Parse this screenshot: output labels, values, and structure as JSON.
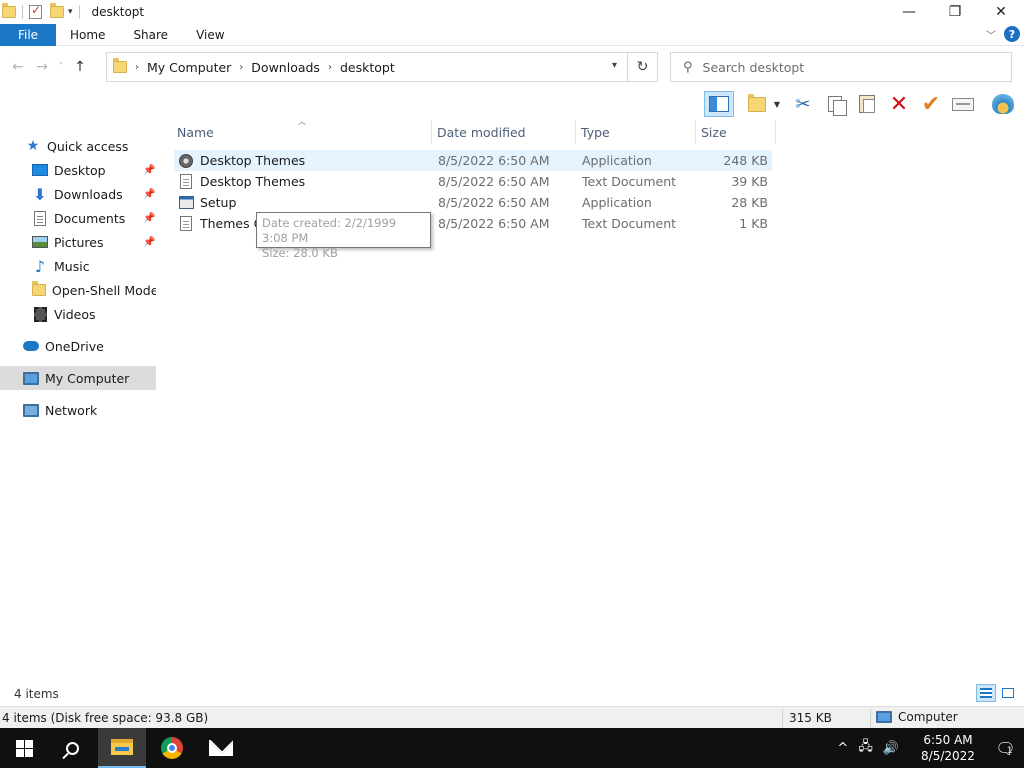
{
  "window": {
    "title": "desktopt",
    "controls": {
      "minimize": "—",
      "restore": "❐",
      "close": "✕"
    }
  },
  "ribbon": {
    "tabs": [
      "File",
      "Home",
      "Share",
      "View"
    ],
    "help": "?",
    "expand": "﹀"
  },
  "address": {
    "crumbs": [
      "My Computer",
      "Downloads",
      "desktopt"
    ],
    "separator": "›",
    "refresh": "↻",
    "dropdown": "▾"
  },
  "search": {
    "placeholder": "Search desktopt"
  },
  "nav": {
    "back": "←",
    "forward": "→",
    "recent": "˅",
    "up": "↑"
  },
  "sidebar": {
    "items": [
      {
        "label": "Quick access",
        "icon": "star-icon"
      },
      {
        "label": "Desktop",
        "icon": "desktop-icon",
        "pinned": true
      },
      {
        "label": "Downloads",
        "icon": "download-icon",
        "pinned": true
      },
      {
        "label": "Documents",
        "icon": "document-icon",
        "pinned": true
      },
      {
        "label": "Pictures",
        "icon": "pictures-icon",
        "pinned": true
      },
      {
        "label": "Music",
        "icon": "music-icon"
      },
      {
        "label": "Open-Shell Modern",
        "icon": "folder-icon"
      },
      {
        "label": "Videos",
        "icon": "video-icon"
      },
      {
        "label": "OneDrive",
        "icon": "cloud-icon"
      },
      {
        "label": "My Computer",
        "icon": "computer-icon",
        "selected": true
      },
      {
        "label": "Network",
        "icon": "network-icon"
      }
    ]
  },
  "list": {
    "columns": [
      "Name",
      "Date modified",
      "Type",
      "Size"
    ],
    "rows": [
      {
        "name": "Desktop Themes",
        "date": "8/5/2022 6:50 AM",
        "type": "Application",
        "size": "248 KB",
        "icon": "application-icon"
      },
      {
        "name": "Desktop Themes",
        "date": "8/5/2022 6:50 AM",
        "type": "Text Document",
        "size": "39 KB",
        "icon": "text-document-icon"
      },
      {
        "name": "Setup",
        "date": "8/5/2022 6:50 AM",
        "type": "Application",
        "size": "28 KB",
        "icon": "setup-icon"
      },
      {
        "name": "Themes CD",
        "date": "8/5/2022 6:50 AM",
        "type": "Text Document",
        "size": "1 KB",
        "icon": "text-document-icon"
      }
    ]
  },
  "tooltip": {
    "created": "Date created: 2/2/1999 3:08 PM",
    "size": "Size: 28.0 KB"
  },
  "status": {
    "count": "4 items",
    "detail": "4 items (Disk free space: 93.8 GB)",
    "total_size": "315 KB",
    "location": "Computer"
  },
  "taskbar": {
    "clock_time": "6:50 AM",
    "clock_date": "8/5/2022",
    "tray_chevron": "^",
    "notification_count": "1"
  },
  "colors": {
    "accent": "#1b78c6",
    "selection": "#dcdcdc",
    "hover": "#e5f3ff",
    "taskbar": "#101010"
  }
}
